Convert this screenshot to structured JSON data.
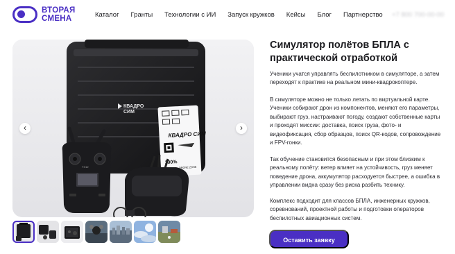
{
  "brand": {
    "name_line1": "ВТОРАЯ",
    "name_line2": "СМЕНА",
    "color": "#4a2fc4"
  },
  "nav": {
    "items": [
      "Каталог",
      "Гранты",
      "Технологии с ИИ",
      "Запуск кружков",
      "Кейсы",
      "Блог",
      "Партнерство"
    ]
  },
  "header": {
    "phone": "+7 800 700-00-00"
  },
  "gallery": {
    "prev_icon": "‹",
    "next_icon": "›",
    "case_label_top": "КВАДРО",
    "case_label_bottom": "СИМ",
    "box_label": "КВАДРО СИМ",
    "box_tag": "100%",
    "box_tag_sub": "DRONE ZONE",
    "controller_label": "TX12",
    "thumbnails": [
      "case-closed",
      "kit-layout",
      "case-open",
      "drone-closeup",
      "city-aerial",
      "sky-view",
      "simulator-screen"
    ],
    "active_thumbnail": 0
  },
  "product": {
    "title": "Симулятор полётов БПЛА с практической отработкой",
    "paragraphs": [
      "Ученики учатся управлять беспилотником в симуляторе, а затем переходят к практике на реальном мини-квадрокоптере.",
      "В симуляторе можно не только летать по виртуальной карте. Ученики собирают дрон из компонентов, меняют его параметры, выбирают груз, настраивают погоду, создают собственные карты и проходят миссии: доставка, поиск груза, фото- и видеофиксация, сбор образцов, поиск QR-кодов, сопровождение и FPV-гонки.",
      "Так обучение становится безопасным и при этом близким к реальному полёту: ветер влияет на устойчивость, груз меняет поведение дрона, аккумулятор расходуется быстрее, а ошибка в управлении видна сразу без риска разбить технику.",
      "Комплекс подходит для классов БПЛА, инженерных кружков, соревнований, проектной работы и подготовки операторов беспилотных авиационных систем."
    ],
    "cta_label": "Оставить заявку"
  }
}
